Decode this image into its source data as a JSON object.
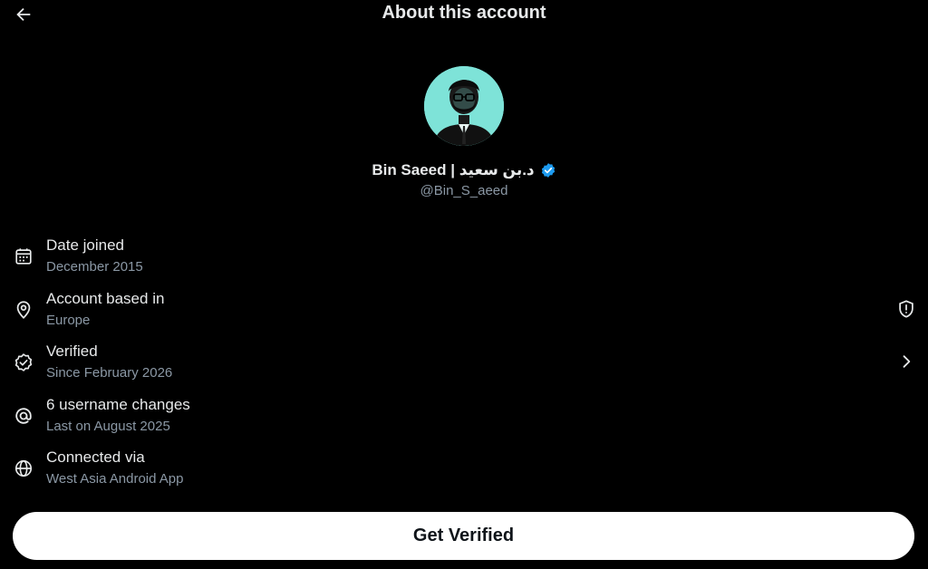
{
  "header": {
    "title": "About this account",
    "back_icon": "arrow-left-icon"
  },
  "profile": {
    "display_name": "Bin Saeed | د.بن سعيد",
    "handle": "@Bin_S_aeed",
    "verified_badge_color": "#1d9bf0",
    "avatar_background": "#7ee3d8"
  },
  "info_rows": [
    {
      "icon": "calendar-icon",
      "label": "Date joined",
      "value": "December 2015"
    },
    {
      "icon": "location-pin-icon",
      "label": "Account based in",
      "value": "Europe",
      "trailing_icon": "shield-alert-icon"
    },
    {
      "icon": "verified-check-icon",
      "label": "Verified",
      "value": "Since February 2026",
      "trailing_icon": "chevron-right-icon"
    },
    {
      "icon": "at-sign-icon",
      "label": "6 username changes",
      "value": "Last on August 2025"
    },
    {
      "icon": "globe-icon",
      "label": "Connected via",
      "value": "West Asia Android App"
    }
  ],
  "cta": {
    "label": "Get Verified"
  },
  "colors": {
    "background": "#000000",
    "primary_text": "#e7e9ea",
    "secondary_text": "#8b98a5",
    "button_bg": "#ffffff",
    "button_text": "#0f1419"
  }
}
